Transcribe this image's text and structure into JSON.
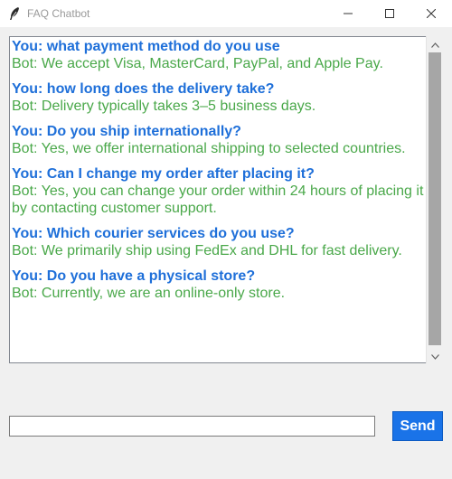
{
  "window": {
    "title": "FAQ Chatbot"
  },
  "icons": {
    "app": "feather-icon",
    "minimize": "minimize-icon",
    "maximize": "maximize-icon",
    "close": "close-icon",
    "scroll_up": "chevron-up-icon",
    "scroll_down": "chevron-down-icon"
  },
  "colors": {
    "user_text": "#1e6fd9",
    "bot_text": "#4aa84a",
    "send_button": "#1a73e8"
  },
  "chat": {
    "messages": [
      {
        "user": "You: what payment method do you use",
        "bot": "Bot: We accept Visa, MasterCard, PayPal, and Apple Pay."
      },
      {
        "user": "You: how long does the delivery take?",
        "bot": "Bot: Delivery typically takes 3–5 business days."
      },
      {
        "user": "You: Do you ship internationally?",
        "bot": "Bot: Yes, we offer international shipping to selected countries."
      },
      {
        "user": "You: Can I change my order after placing it?",
        "bot": "Bot: Yes, you can change your order within 24 hours of placing it by contacting customer support."
      },
      {
        "user": "You: Which courier services do you use?",
        "bot": "Bot: We primarily ship using FedEx and DHL for fast delivery."
      },
      {
        "user": "You: Do you have a physical store?",
        "bot": "Bot: Currently, we are an online-only store."
      }
    ]
  },
  "input": {
    "value": "",
    "placeholder": ""
  },
  "send": {
    "label": "Send"
  }
}
